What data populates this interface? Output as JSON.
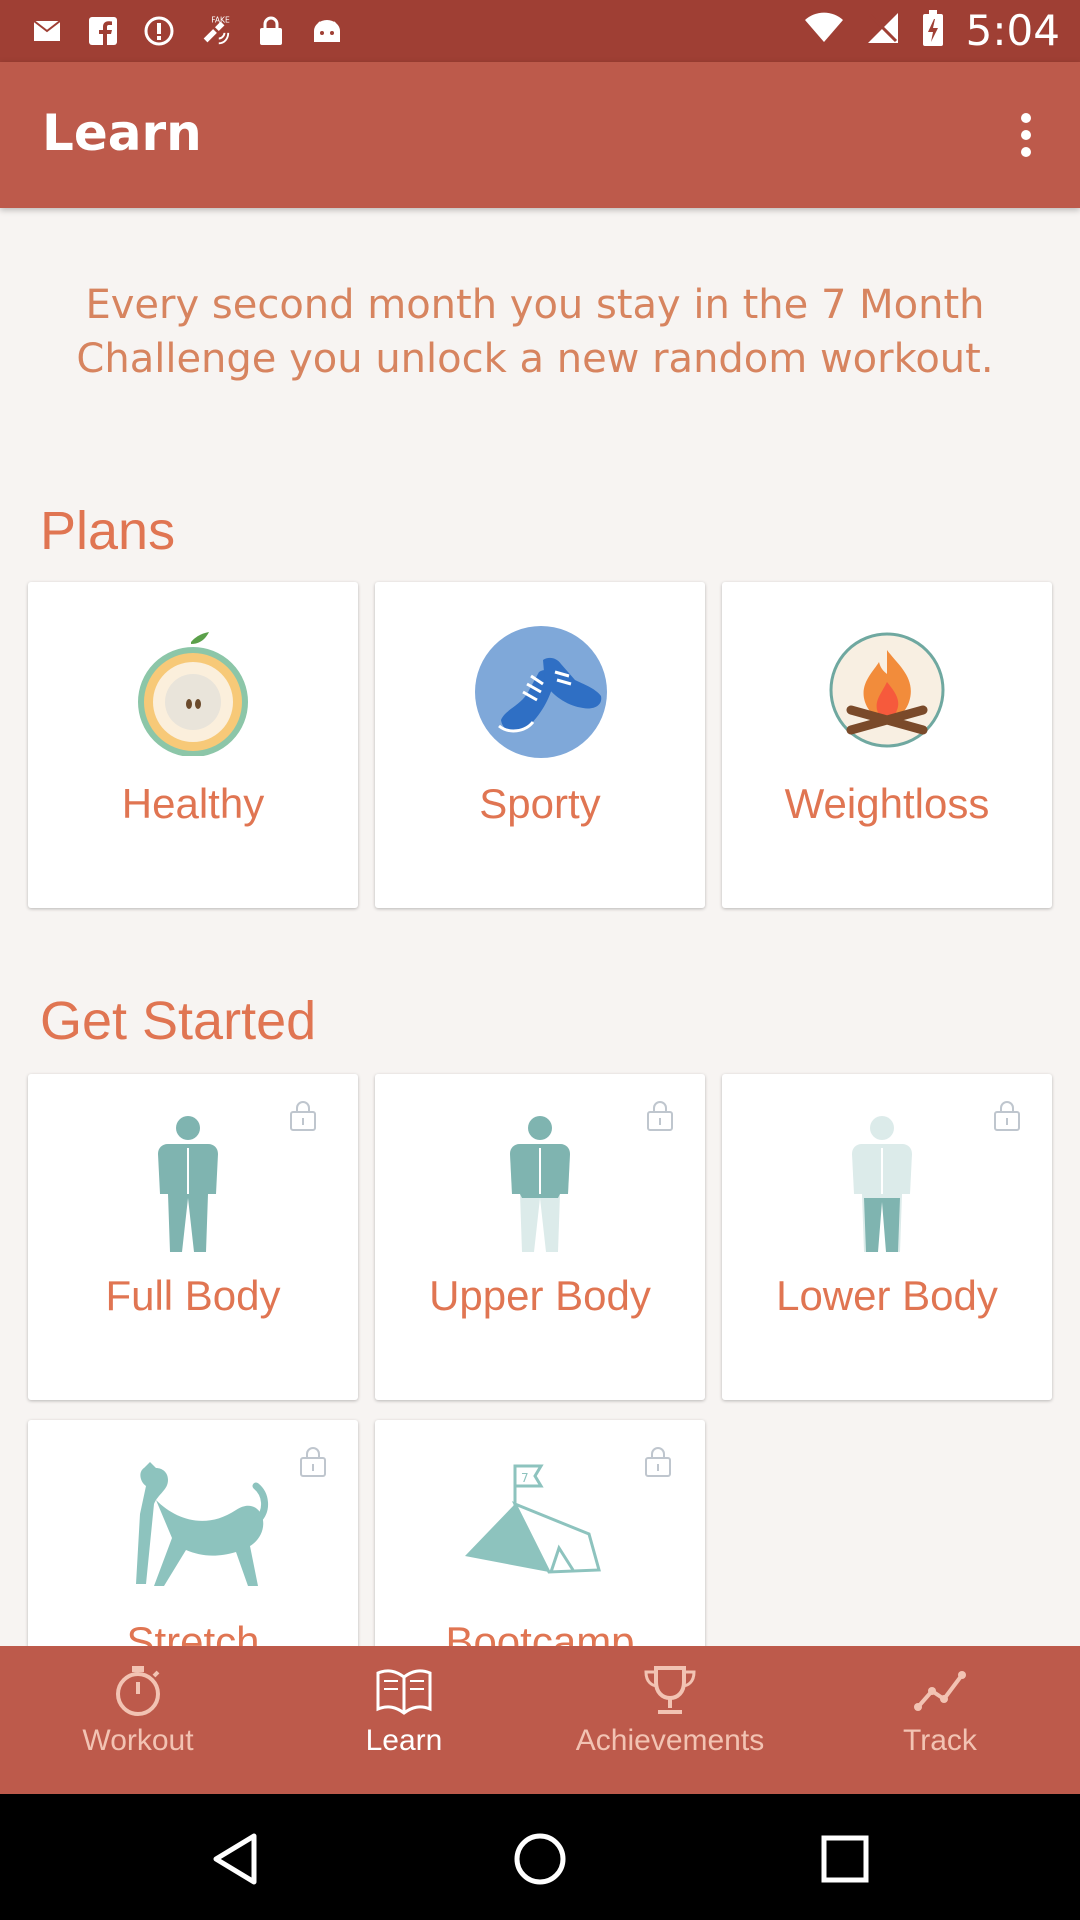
{
  "status_bar": {
    "time": "5:04",
    "left_icons": [
      "mail-icon",
      "facebook-icon",
      "info-icon",
      "fake-gps-icon",
      "lock-icon",
      "android-icon"
    ],
    "right_icons": [
      "wifi-icon",
      "signal-off-icon",
      "battery-charging-icon"
    ]
  },
  "app_bar": {
    "title": "Learn",
    "menu_icon": "more-vert-icon"
  },
  "intro_text": "Every second month you stay in the 7 Month Challenge you unlock a new random workout.",
  "plans": {
    "heading": "Plans",
    "items": [
      {
        "label": "Healthy",
        "icon": "apple-icon"
      },
      {
        "label": "Sporty",
        "icon": "sneakers-icon"
      },
      {
        "label": "Weightloss",
        "icon": "campfire-icon"
      }
    ]
  },
  "get_started": {
    "heading": "Get Started",
    "items": [
      {
        "label": "Full Body",
        "icon": "body-full-icon",
        "locked": true
      },
      {
        "label": "Upper Body",
        "icon": "body-upper-icon",
        "locked": true
      },
      {
        "label": "Lower Body",
        "icon": "body-lower-icon",
        "locked": true
      },
      {
        "label": "Stretch",
        "icon": "cat-stretch-icon",
        "locked": true
      },
      {
        "label": "Bootcamp",
        "icon": "tent-icon",
        "locked": true
      }
    ]
  },
  "bottom_nav": {
    "items": [
      {
        "label": "Workout",
        "icon": "stopwatch-icon",
        "active": false
      },
      {
        "label": "Learn",
        "icon": "book-icon",
        "active": true
      },
      {
        "label": "Achievements",
        "icon": "trophy-icon",
        "active": false
      },
      {
        "label": "Track",
        "icon": "chart-line-icon",
        "active": false
      }
    ]
  },
  "colors": {
    "status_bar": "#9F3F34",
    "app_bar": "#BD5A4B",
    "accent_text": "#E07552",
    "intro_text": "#D7845F",
    "background": "#F7F4F2"
  }
}
